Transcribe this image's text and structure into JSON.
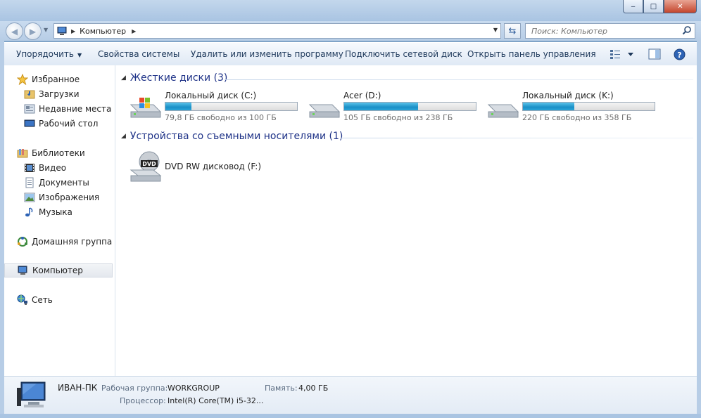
{
  "window": {
    "caption_min": "‒",
    "caption_max": "□",
    "caption_close": "✕"
  },
  "address_bar": {
    "path": "Компьютер",
    "search_placeholder": "Поиск: Компьютер"
  },
  "command_bar": {
    "organize": "Упорядочить",
    "system_properties": "Свойства системы",
    "uninstall": "Удалить или изменить программу",
    "map_drive": "Подключить сетевой диск",
    "control_panel": "Открыть панель управления"
  },
  "nav_pane": {
    "favorites": "Избранное",
    "downloads": "Загрузки",
    "recent": "Недавние места",
    "desktop": "Рабочий стол",
    "libraries": "Библиотеки",
    "video": "Видео",
    "documents": "Документы",
    "images": "Изображения",
    "music": "Музыка",
    "homegroup": "Домашняя группа",
    "computer": "Компьютер",
    "network": "Сеть"
  },
  "content": {
    "hard_drives_header": "Жесткие диски (3)",
    "removable_header": "Устройства со съемными носителями (1)",
    "drives": [
      {
        "name": "Локальный диск (C:)",
        "free_text": "79,8 ГБ свободно из 100 ГБ",
        "used_fraction": 0.2
      },
      {
        "name": "Acer (D:)",
        "free_text": "105 ГБ свободно из 238 ГБ",
        "used_fraction": 0.56
      },
      {
        "name": "Локальный диск (K:)",
        "free_text": "220 ГБ свободно из 358 ГБ",
        "used_fraction": 0.39
      }
    ],
    "dvd": {
      "name": "DVD RW дисковод (F:)",
      "badge": "DVD"
    }
  },
  "details": {
    "computer_name": "ИВАН-ПК",
    "workgroup_label": "Рабочая группа:",
    "workgroup_value": "WORKGROUP",
    "memory_label": "Память:",
    "memory_value": "4,00 ГБ",
    "cpu_label": "Процессор:",
    "cpu_value": "Intel(R) Core(TM) i5-32..."
  },
  "colors": {
    "accent": "#1e3287",
    "bar_fill": "#2ba4d8"
  }
}
